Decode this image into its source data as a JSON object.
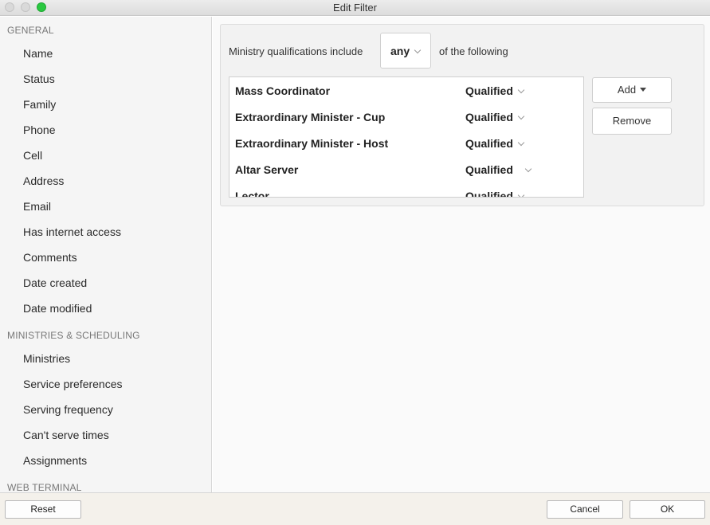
{
  "window": {
    "title": "Edit Filter"
  },
  "sidebar": {
    "sections": [
      {
        "header": "GENERAL",
        "items": [
          "Name",
          "Status",
          "Family",
          "Phone",
          "Cell",
          "Address",
          "Email",
          "Has internet access",
          "Comments",
          "Date created",
          "Date modified"
        ]
      },
      {
        "header": "MINISTRIES & SCHEDULING",
        "items": [
          "Ministries",
          "Service preferences",
          "Serving frequency",
          "Can't serve times",
          "Assignments"
        ]
      },
      {
        "header": "WEB TERMINAL",
        "items": []
      }
    ]
  },
  "condition": {
    "prefix": "Ministry qualifications include",
    "match": "any",
    "suffix": "of the following"
  },
  "qualifications": [
    {
      "name": "Mass Coordinator",
      "status": "Qualified"
    },
    {
      "name": "Extraordinary Minister - Cup",
      "status": "Qualified"
    },
    {
      "name": "Extraordinary Minister - Host",
      "status": "Qualified"
    },
    {
      "name": "Altar Server",
      "status": "Qualified"
    },
    {
      "name": "Lector",
      "status": "Qualified"
    }
  ],
  "buttons": {
    "add": "Add",
    "remove": "Remove"
  },
  "footer": {
    "reset": "Reset",
    "cancel": "Cancel",
    "ok": "OK"
  }
}
